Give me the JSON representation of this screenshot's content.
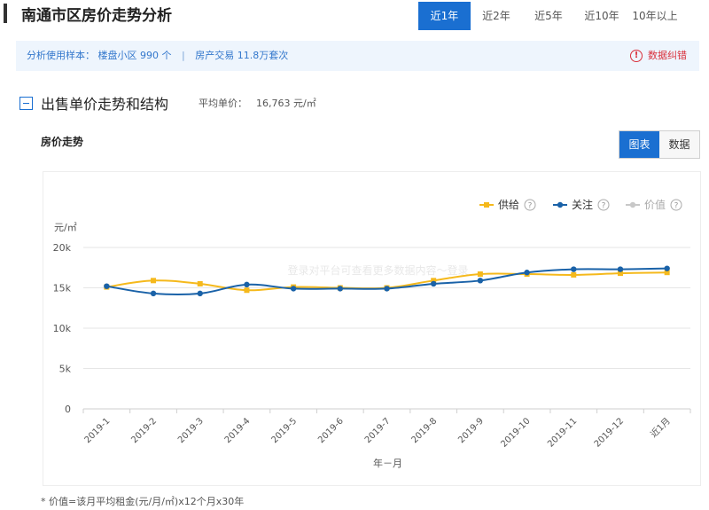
{
  "page": {
    "title": "南通市区房价走势分析"
  },
  "tabs": [
    {
      "label": "近1年",
      "active": true
    },
    {
      "label": "近2年",
      "active": false
    },
    {
      "label": "近5年",
      "active": false
    },
    {
      "label": "近10年",
      "active": false
    },
    {
      "label": "10年以上",
      "active": false
    }
  ],
  "info": {
    "sample_label": "分析使用样本：",
    "community_text": "楼盘小区 990 个",
    "separator": "|",
    "transaction_text": "房产交易 11.8万套次",
    "error_label": "数据纠错",
    "error_icon": "alert-circle-icon"
  },
  "section": {
    "title": "出售单价走势和结构",
    "avg_label": "平均单价：",
    "avg_value": "16,763 元/㎡",
    "collapse_icon": "minus-square-icon"
  },
  "chart_panel": {
    "title": "房价走势",
    "view_chart": "图表",
    "view_data": "数据"
  },
  "colors": {
    "accent": "#1a6fd1",
    "supply": "#f5b91c",
    "attention": "#1a62a8",
    "value": "#c8c8c8",
    "grid": "#e6e6e6"
  },
  "chart_data": {
    "type": "line",
    "ylabel": "元/㎡",
    "xlabel": "年－月",
    "ylim": [
      0,
      20000
    ],
    "yticks": [
      0,
      5000,
      10000,
      15000,
      20000
    ],
    "ytick_labels": [
      "0",
      "5k",
      "10k",
      "15k",
      "20k"
    ],
    "categories": [
      "2019-1",
      "2019-2",
      "2019-3",
      "2019-4",
      "2019-5",
      "2019-6",
      "2019-7",
      "2019-8",
      "2019-9",
      "2019-10",
      "2019-11",
      "2019-12",
      "近1月"
    ],
    "legend_position": "top-right",
    "grid": true,
    "series": [
      {
        "name": "供给",
        "color": "#f5b91c",
        "visible": true,
        "values": [
          15100,
          15900,
          15500,
          14700,
          15100,
          15000,
          15000,
          15900,
          16700,
          16700,
          16600,
          16800,
          16900
        ]
      },
      {
        "name": "关注",
        "color": "#1a62a8",
        "visible": true,
        "values": [
          15200,
          14300,
          14300,
          15400,
          14900,
          14900,
          14900,
          15500,
          15900,
          16900,
          17300,
          17300,
          17400
        ]
      },
      {
        "name": "价值",
        "color": "#c8c8c8",
        "visible": false,
        "values": []
      }
    ],
    "legend_help_icon": "question-circle-icon",
    "watermark": "登录对平台可查看更多数据内容～登录"
  },
  "footnote": "* 价值=该月平均租金(元/月/㎡)x12个月x30年"
}
